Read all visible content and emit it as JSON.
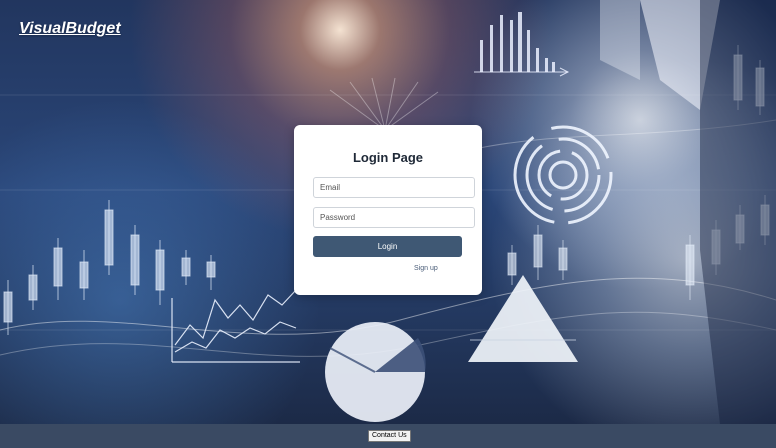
{
  "brand": {
    "name": "VisualBudget"
  },
  "login": {
    "title": "Login Page",
    "email_placeholder": "Email",
    "password_placeholder": "Password",
    "login_label": "Login",
    "signup_label": "Sign up"
  },
  "footer": {
    "contact_label": "Contact Us"
  },
  "colors": {
    "login_button": "#3f5874",
    "footer_bg": "#3a4a63",
    "background": "#2a4678"
  }
}
